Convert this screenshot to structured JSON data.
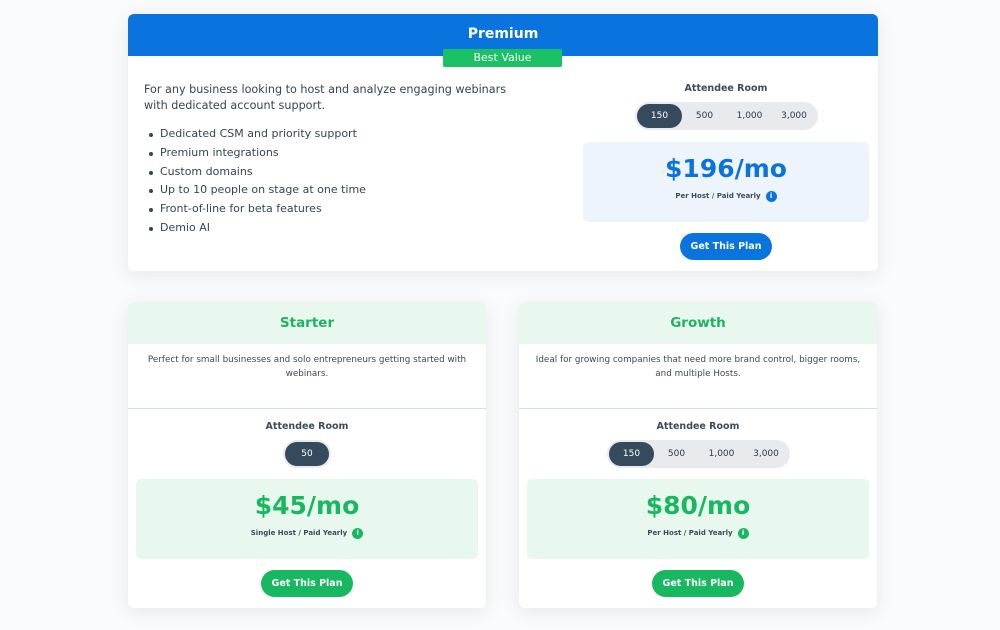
{
  "premium": {
    "title": "Premium",
    "badge": "Best Value",
    "description": "For any business looking to host and analyze engaging webinars with dedicated account support.",
    "features": [
      "Dedicated CSM and priority support",
      "Premium integrations",
      "Custom domains",
      "Up to 10 people on stage at one time",
      "Front-of-line for beta features",
      "Demio AI"
    ],
    "room_label": "Attendee Room",
    "rooms": [
      "150",
      "500",
      "1,000",
      "3,000"
    ],
    "selected_room": "150",
    "price": "$196/mo",
    "price_note": "Per Host / Paid Yearly",
    "cta": "Get This Plan",
    "accent": "#0a74de"
  },
  "starter": {
    "title": "Starter",
    "description": "Perfect for small businesses and solo entrepreneurs getting started with webinars.",
    "room_label": "Attendee Room",
    "rooms": [
      "50"
    ],
    "selected_room": "50",
    "price": "$45/mo",
    "price_note": "Single Host / Paid Yearly",
    "cta": "Get This Plan",
    "accent": "#18b860"
  },
  "growth": {
    "title": "Growth",
    "description": "Ideal for growing companies that need more brand control, bigger rooms, and multiple Hosts.",
    "room_label": "Attendee Room",
    "rooms": [
      "150",
      "500",
      "1,000",
      "3,000"
    ],
    "selected_room": "150",
    "price": "$80/mo",
    "price_note": "Per Host / Paid Yearly",
    "cta": "Get This Plan",
    "accent": "#18b860"
  },
  "icons": {
    "info": "info-icon"
  }
}
